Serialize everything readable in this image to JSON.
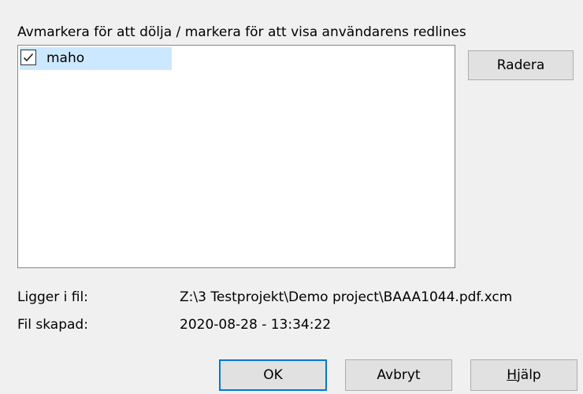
{
  "dialog": {
    "instruction": "Avmarkera för att dölja / markera för att visa användarens redlines",
    "users": [
      {
        "label": "maho",
        "checked": true,
        "selected": true
      }
    ],
    "delete_label": "Radera",
    "file_label": "Ligger i fil:",
    "file_value": "Z:\\3 Testprojekt\\Demo project\\BAAA1044.pdf.xcm",
    "created_label": "Fil skapad:",
    "created_value": "2020-08-28 - 13:34:22",
    "ok_label": "OK",
    "cancel_label": "Avbryt",
    "help_label": {
      "mnemonic": "H",
      "rest": "jälp"
    }
  },
  "colors": {
    "dialog_background": "#f0f0f0",
    "selection": "#cce8ff",
    "default_button_border": "#0078d7",
    "button_face": "#e1e1e1"
  }
}
